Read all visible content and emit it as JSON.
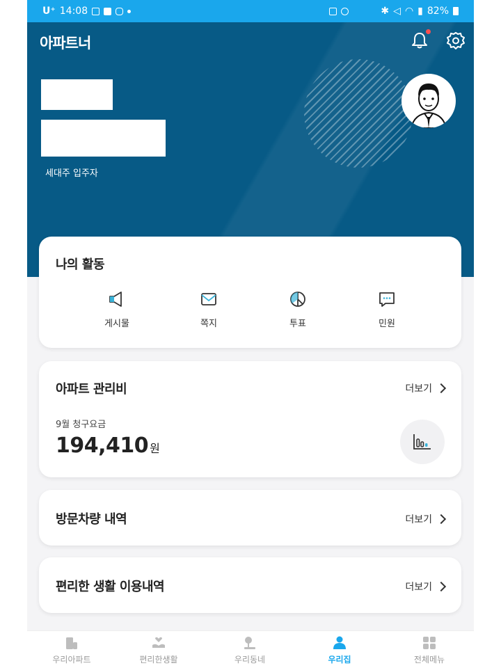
{
  "status_bar": {
    "carrier": "U⁺",
    "time": "14:08",
    "battery": "82%"
  },
  "header": {
    "app_title": "아파트너",
    "resident_role": "세대주 입주자"
  },
  "activity": {
    "title": "나의 활동",
    "items": [
      {
        "label": "게시물",
        "icon": "megaphone-icon"
      },
      {
        "label": "쪽지",
        "icon": "mail-icon"
      },
      {
        "label": "투표",
        "icon": "vote-icon"
      },
      {
        "label": "민원",
        "icon": "chat-icon"
      }
    ]
  },
  "management_fee": {
    "title": "아파트 관리비",
    "more_label": "더보기",
    "bill_label": "9월 청구요금",
    "amount": "194,410",
    "unit": "원"
  },
  "visitor_vehicles": {
    "title": "방문차량 내역",
    "more_label": "더보기"
  },
  "convenience": {
    "title": "편리한 생활 이용내역",
    "more_label": "더보기"
  },
  "bottom_nav": {
    "items": [
      {
        "label": "우리아파트",
        "icon": "apartment-icon"
      },
      {
        "label": "편리한생활",
        "icon": "hand-heart-icon"
      },
      {
        "label": "우리동네",
        "icon": "neighborhood-icon"
      },
      {
        "label": "우리집",
        "icon": "person-icon",
        "active": true
      },
      {
        "label": "전체메뉴",
        "icon": "grid-icon"
      }
    ]
  },
  "colors": {
    "accent": "#1aa7ec",
    "hero": "#075a86",
    "notification": "#ff4f4f"
  }
}
